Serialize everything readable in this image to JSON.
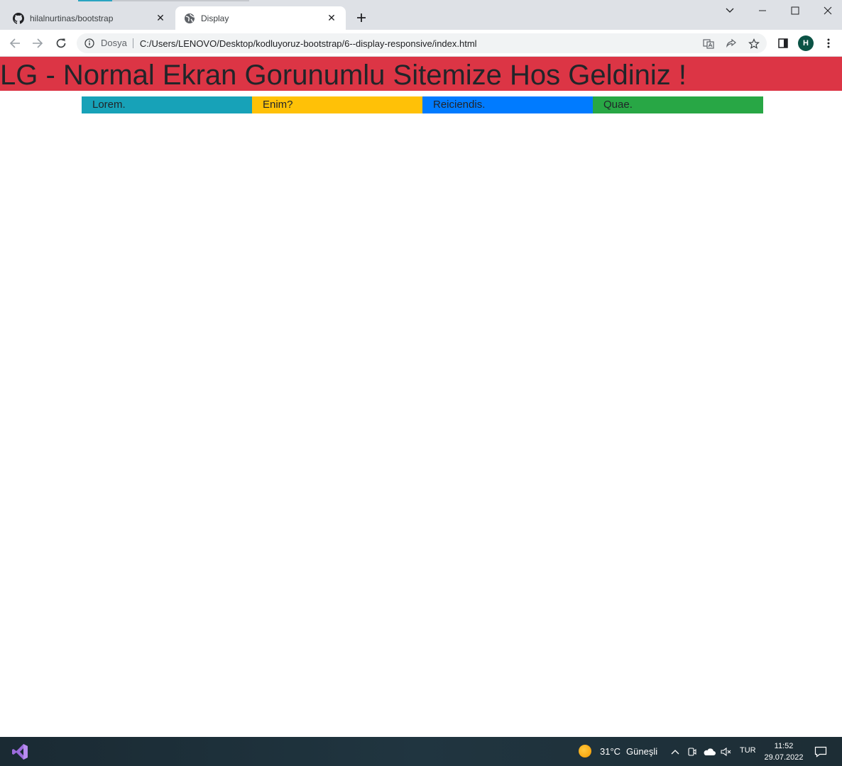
{
  "browser": {
    "tabs": [
      {
        "title": "hilalnurtinas/bootstrap",
        "icon": "github-icon",
        "active": false
      },
      {
        "title": "Display",
        "icon": "globe-icon",
        "active": true
      }
    ],
    "omnibox": {
      "scheme_label": "Dosya",
      "url": "C:/Users/LENOVO/Desktop/kodluyoruz-bootstrap/6--display-responsive/index.html"
    },
    "profile_initial": "H"
  },
  "page": {
    "banner_text": "LG - Normal Ekran Gorunumlu Sitemize Hos Geldiniz !",
    "banner_color": "#dc3545",
    "columns": [
      {
        "label": "Lorem.",
        "color": "#17a2b8"
      },
      {
        "label": "Enim?",
        "color": "#ffc107"
      },
      {
        "label": "Reiciendis.",
        "color": "#007bff"
      },
      {
        "label": "Quae.",
        "color": "#28a745"
      }
    ]
  },
  "taskbar": {
    "temperature": "31°C",
    "weather": "Güneşli",
    "language": "TUR",
    "time": "11:52",
    "date": "29.07.2022"
  }
}
